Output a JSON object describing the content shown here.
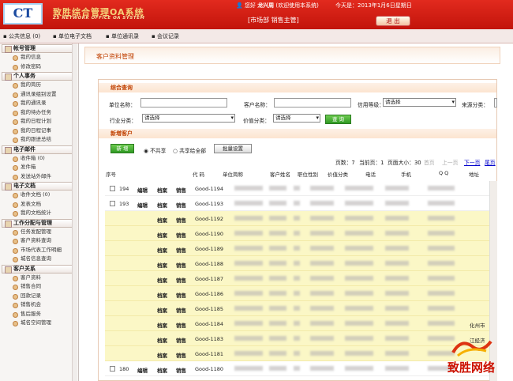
{
  "header": {
    "logo_text": "CT",
    "brand_name": "致胜综合管理OA系统",
    "brand_en": "ZS NETWORK OFFICE OA SYSTEM",
    "welcome_prefix": "您好",
    "user_name": "龙兴周",
    "welcome_suffix": "(欢迎使用本系统)",
    "today": "今天是：2013年1月6日星期日",
    "department": "[市场部 销售主管]",
    "logout_label": "退 出"
  },
  "nav": [
    "公共信息 (0)",
    "单位电子文档",
    "单位通讯录",
    "会议记录"
  ],
  "sidebar": [
    {
      "title": "帐号管理",
      "items": [
        "我的信息",
        "修改密码"
      ]
    },
    {
      "title": "个人事务",
      "items": [
        "我的简历",
        "通讯录组别设置",
        "我的通讯录",
        "我的待办任务",
        "我的日程计划",
        "我的日程记事",
        "我的跟进总结"
      ]
    },
    {
      "title": "电子邮件",
      "items": [
        "收件箱 (0)",
        "发件箱",
        "发送站外邮件"
      ]
    },
    {
      "title": "电子文档",
      "items": [
        "收件文档 (0)",
        "发表文档",
        "我的文档统计"
      ]
    },
    {
      "title": "工作分配与管理",
      "items": [
        "任务发配管理",
        "客户资料查询",
        "市场代表工作明细",
        "城名信息查询"
      ]
    },
    {
      "title": "客户关系",
      "items": [
        "客户资料",
        "销售合同",
        "回款记录",
        "销售机会",
        "售后服务",
        "城名空间管理"
      ]
    }
  ],
  "breadcrumb": "客户资料管理",
  "search": {
    "section_title": "综合查询",
    "unit_name_label": "单位名称：",
    "customer_name_label": "客户名称：",
    "credit_level_label": "信用等级：",
    "credit_level_value": "请选择",
    "source_label": "来源分类：",
    "industry_label": "行业分类：",
    "industry_value": "请选择",
    "value_label": "价值分类：",
    "value_value": "请选择",
    "query_button": "查 询"
  },
  "add": {
    "section_title": "新增客户",
    "new_button": "新 增",
    "radio_private": "不共享",
    "radio_share": "共享给全部",
    "batch_button": "批量设置"
  },
  "pager": {
    "pages": "页数：7",
    "current": "当前页：1",
    "page_size": "页面大小：30",
    "first": "首页",
    "prev": "上一页",
    "next": "下一页",
    "last": "尾页"
  },
  "table": {
    "headers": [
      "序号",
      "代 码",
      "单位简称",
      "客户姓名",
      "职位性别",
      "价值分类",
      "电话",
      "手机",
      "Q Q",
      "地址"
    ],
    "rows": [
      {
        "num": "194",
        "edit": "编辑",
        "file": "档案",
        "sale": "销售",
        "code": "Good-1194",
        "checkbox": true,
        "hl": false
      },
      {
        "num": "193",
        "edit": "编辑",
        "file": "档案",
        "sale": "销售",
        "code": "Good-1193",
        "checkbox": true,
        "hl": false
      },
      {
        "num": "",
        "edit": "",
        "file": "档案",
        "sale": "销售",
        "code": "Good-1192",
        "checkbox": false,
        "hl": true
      },
      {
        "num": "",
        "edit": "",
        "file": "档案",
        "sale": "销售",
        "code": "Good-1190",
        "checkbox": false,
        "hl": true
      },
      {
        "num": "",
        "edit": "",
        "file": "档案",
        "sale": "销售",
        "code": "Good-1189",
        "checkbox": false,
        "hl": true
      },
      {
        "num": "",
        "edit": "",
        "file": "档案",
        "sale": "销售",
        "code": "Good-1188",
        "checkbox": false,
        "hl": true
      },
      {
        "num": "",
        "edit": "",
        "file": "档案",
        "sale": "销售",
        "code": "Good-1187",
        "checkbox": false,
        "hl": true
      },
      {
        "num": "",
        "edit": "",
        "file": "档案",
        "sale": "销售",
        "code": "Good-1186",
        "checkbox": false,
        "hl": true
      },
      {
        "num": "",
        "edit": "",
        "file": "档案",
        "sale": "销售",
        "code": "Good-1185",
        "checkbox": false,
        "hl": true
      },
      {
        "num": "",
        "edit": "",
        "file": "档案",
        "sale": "销售",
        "code": "Good-1184",
        "checkbox": false,
        "hl": true,
        "address": "化州市"
      },
      {
        "num": "",
        "edit": "",
        "file": "档案",
        "sale": "销售",
        "code": "Good-1183",
        "checkbox": false,
        "hl": true,
        "address": "江经济"
      },
      {
        "num": "",
        "edit": "",
        "file": "档案",
        "sale": "销售",
        "code": "Good-1181",
        "checkbox": false,
        "hl": true
      },
      {
        "num": "180",
        "edit": "编辑",
        "file": "档案",
        "sale": "销售",
        "code": "Good-1180",
        "checkbox": true,
        "hl": false
      }
    ]
  },
  "watermark": "致胜网络"
}
